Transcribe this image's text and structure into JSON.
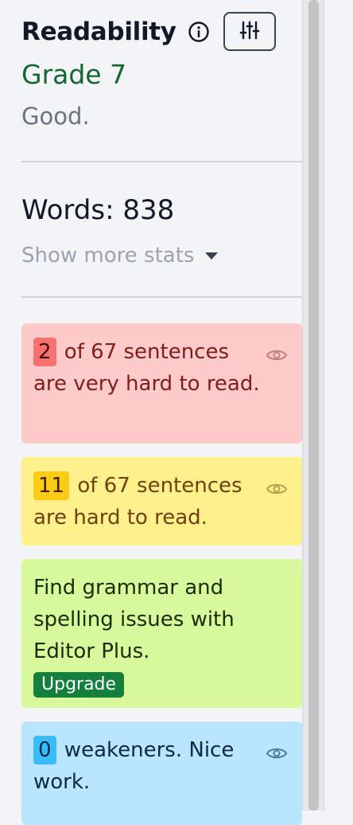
{
  "header": {
    "title": "Readability",
    "info_icon": "info-icon",
    "settings_icon": "sliders-icon"
  },
  "readability": {
    "grade": "Grade 7",
    "description": "Good."
  },
  "stats": {
    "words": "Words: 838",
    "more_stats_label": "Show more stats"
  },
  "cards": {
    "very_hard": {
      "count": "2",
      "text": " of 67 sentences are very hard to read.",
      "color": "#fecaca",
      "badge_color": "#f87171"
    },
    "hard": {
      "count": "11",
      "text": " of 67 sentences are hard to read.",
      "color": "#fef08a",
      "badge_color": "#facc15"
    },
    "upgrade": {
      "text": "Find grammar and spelling issues with Editor Plus.",
      "button_label": "Upgrade",
      "color": "#d9f99d",
      "button_color": "#15803d"
    },
    "weakeners": {
      "count": "0",
      "text": " weakeners. Nice work.",
      "color": "#bae6fd",
      "badge_color": "#38bdf8"
    }
  },
  "colors": {
    "grade_green": "#166534",
    "panel_bg": "#f3f4f6"
  }
}
